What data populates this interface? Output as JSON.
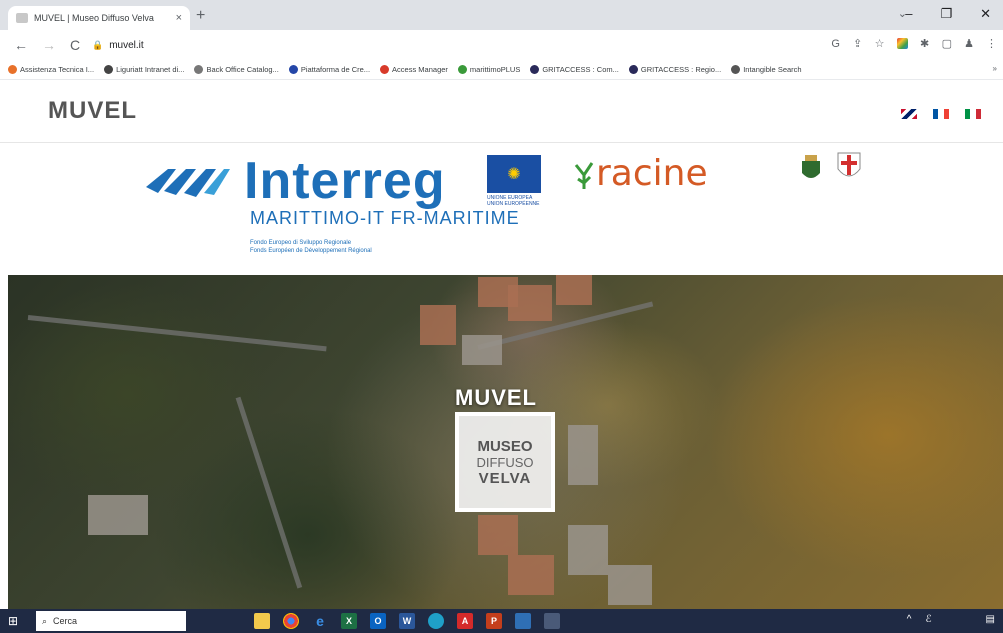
{
  "browser": {
    "tab_title": "MUVEL | Museo Diffuso Velva",
    "tab_close": "×",
    "new_tab": "+",
    "tab_dropdown": "⌄",
    "minimize": "–",
    "maximize": "❐",
    "close": "✕",
    "back": "←",
    "forward": "→",
    "reload": "C",
    "url": "muvel.it",
    "ext_icons": [
      "G",
      "⇪",
      "☆",
      "",
      "✱",
      "▢",
      "♟",
      "⋮"
    ]
  },
  "bookmarks": [
    {
      "label": "Assistenza Tecnica I...",
      "color": "#e8712a"
    },
    {
      "label": "Liguriatt Intranet di...",
      "color": "#444444"
    },
    {
      "label": "Back Office Catalog...",
      "color": "#777777"
    },
    {
      "label": "Piattaforma de Cre...",
      "color": "#2446a8"
    },
    {
      "label": "Access Manager",
      "color": "#d83a2a"
    },
    {
      "label": "marittimoPLUS",
      "color": "#3a9a3a"
    },
    {
      "label": "GRITACCESS : Com...",
      "color": "#2a2a5a"
    },
    {
      "label": "GRITACCESS : Regio...",
      "color": "#2a2a5a"
    },
    {
      "label": "Intangible Search",
      "color": "#555555"
    }
  ],
  "bookmarks_more": "»",
  "site": {
    "logo": "MUVEL",
    "languages": [
      "en",
      "fr",
      "it"
    ]
  },
  "partners": {
    "interreg": "Interreg",
    "eu_caption": "UNIONE EUROPEA UNION EUROPÉENNE",
    "marittimo": "MARITTIMO-IT FR-MARITIME",
    "fondo_line1": "Fondo Europeo di Sviluppo Regionale",
    "fondo_line2": "Fonds Européen de Développement Régional",
    "racine": "racine"
  },
  "hero": {
    "title": "MUVEL",
    "box_line1": "MUSEO",
    "box_line2": "DIFFUSO",
    "box_line3": "VELVA"
  },
  "taskbar": {
    "search_placeholder": "Cerca",
    "tray_up": "^",
    "tray_icon": "ℰ",
    "notification": "▤"
  }
}
